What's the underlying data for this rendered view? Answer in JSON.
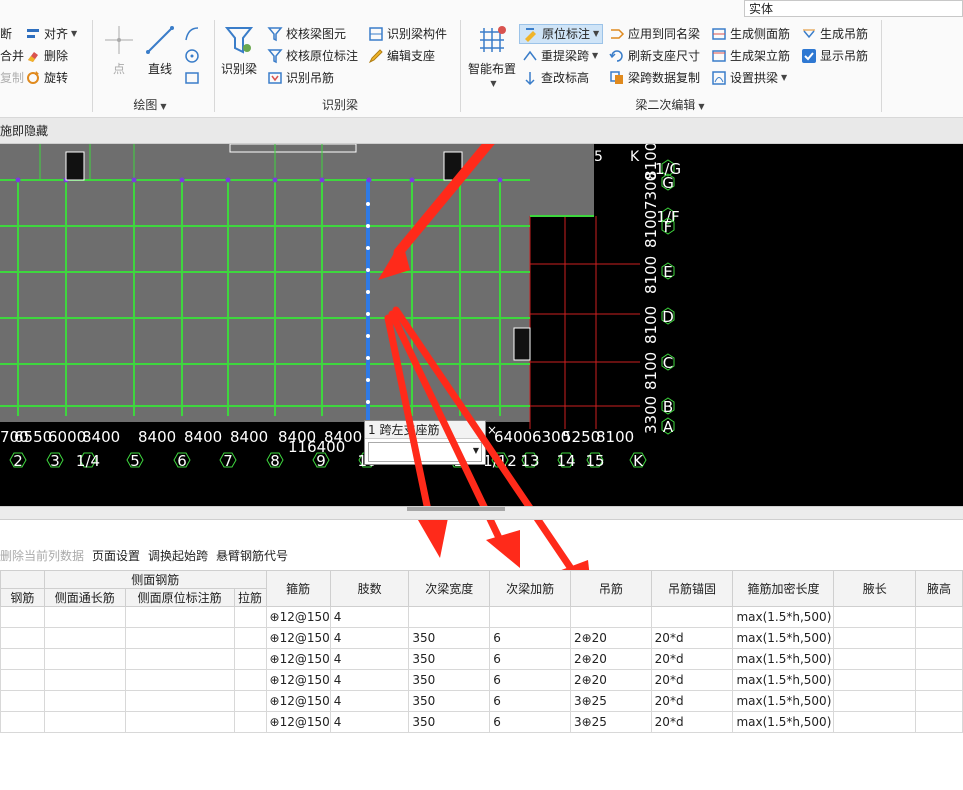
{
  "search": {
    "value": "实体"
  },
  "ribbon": {
    "col0": [
      {
        "label": "断",
        "icon": "break-icon"
      },
      {
        "label": "合并",
        "icon": "merge-icon"
      },
      {
        "label": "复制",
        "icon": "copy-icon"
      }
    ],
    "col1": [
      {
        "label": "对齐",
        "icon": "align-icon"
      },
      {
        "label": "删除",
        "icon": "delete-icon"
      },
      {
        "label": "旋转",
        "icon": "rotate-icon"
      }
    ],
    "draw": {
      "point": "点",
      "line": "直线",
      "group": "绘图"
    },
    "identify": {
      "big": "识别梁",
      "items": [
        {
          "label": "校核梁图元"
        },
        {
          "label": "校核原位标注"
        },
        {
          "label": "识别吊筋"
        },
        {
          "label": "识别梁构件"
        },
        {
          "label": "编辑支座"
        }
      ],
      "group": "识别梁"
    },
    "edit2": {
      "big": "智能布置",
      "items": [
        {
          "label": "原位标注"
        },
        {
          "label": "重提梁跨"
        },
        {
          "label": "查改标高"
        },
        {
          "label": "应用到同名梁"
        },
        {
          "label": "刷新支座尺寸"
        },
        {
          "label": "梁跨数据复制"
        },
        {
          "label": "生成侧面筋"
        },
        {
          "label": "生成架立筋"
        },
        {
          "label": "设置拱梁"
        },
        {
          "label": "生成吊筋"
        },
        {
          "label": "显示吊筋"
        }
      ],
      "group": "梁二次编辑"
    }
  },
  "hint_bar": {
    "text": "施即隐藏"
  },
  "canvas": {
    "dims_bottom": [
      "700",
      "6550",
      "6000",
      "8400",
      "8400",
      "8400",
      "8400",
      "8400",
      "8400",
      "6400",
      "6300",
      "5250",
      "8100"
    ],
    "total_dim": "116400",
    "axes_bottom": [
      "2",
      "3",
      "1/4",
      "5",
      "6",
      "7",
      "8",
      "9",
      "10",
      "1",
      "1/12",
      "13",
      "14",
      "15",
      "K"
    ],
    "axes_right": [
      "1/G",
      "G",
      "1/F",
      "F",
      "E",
      "D",
      "C",
      "B",
      "A"
    ],
    "dims_right": [
      "3300",
      "8100",
      "8100",
      "8100",
      "8100",
      "7300",
      "8100"
    ],
    "top_labels": [
      "5",
      "K"
    ],
    "popup": {
      "title": "1 跨左支座筋",
      "close": "×",
      "value": ""
    }
  },
  "table_toolbar": [
    {
      "label": "删除当前列数据",
      "disabled": true
    },
    {
      "label": "页面设置",
      "disabled": false
    },
    {
      "label": "调换起始跨",
      "disabled": false
    },
    {
      "label": "悬臂钢筋代号",
      "disabled": false
    }
  ],
  "grid": {
    "group_header": "侧面钢筋",
    "headers": [
      "钢筋",
      "侧面通长筋",
      "侧面原位标注筋",
      "拉筋",
      "箍筋",
      "肢数",
      "次梁宽度",
      "次梁加筋",
      "吊筋",
      "吊筋锚固",
      "箍筋加密长度",
      "腋长",
      "腋高"
    ],
    "rows": [
      [
        "",
        "",
        "",
        "",
        "⊕12@150",
        "4",
        "",
        "",
        "",
        "",
        "max(1.5*h,500)",
        "",
        ""
      ],
      [
        "",
        "",
        "",
        "",
        "⊕12@150",
        "4",
        "350",
        "6",
        "2⊕20",
        "20*d",
        "max(1.5*h,500)",
        "",
        ""
      ],
      [
        "",
        "",
        "",
        "",
        "⊕12@150",
        "4",
        "350",
        "6",
        "2⊕20",
        "20*d",
        "max(1.5*h,500)",
        "",
        ""
      ],
      [
        "",
        "",
        "",
        "",
        "⊕12@150",
        "4",
        "350",
        "6",
        "2⊕20",
        "20*d",
        "max(1.5*h,500)",
        "",
        ""
      ],
      [
        "",
        "",
        "",
        "",
        "⊕12@150",
        "4",
        "350",
        "6",
        "3⊕25",
        "20*d",
        "max(1.5*h,500)",
        "",
        ""
      ],
      [
        "",
        "",
        "",
        "",
        "⊕12@150",
        "4",
        "350",
        "6",
        "3⊕25",
        "20*d",
        "max(1.5*h,500)",
        "",
        ""
      ]
    ]
  }
}
